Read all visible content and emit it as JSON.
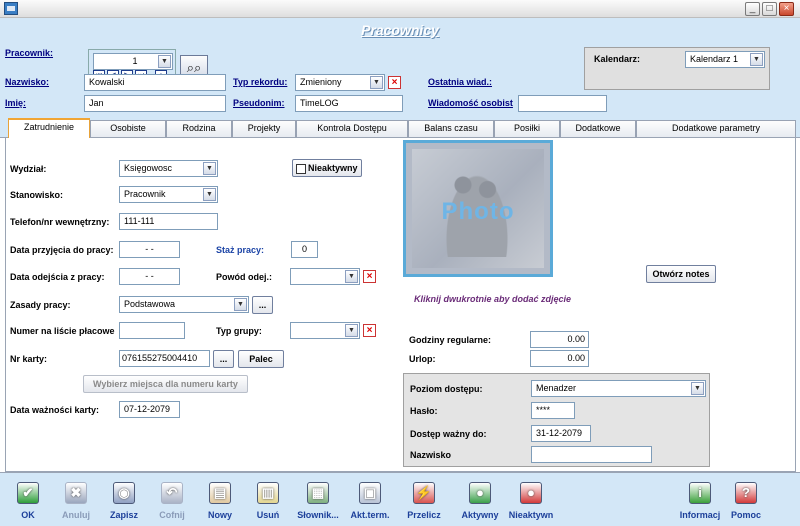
{
  "header": {
    "title": "Pracownicy",
    "pracownik_label": "Pracownik:",
    "pracownik_value": "1",
    "nazwisko_label": "Nazwisko:",
    "nazwisko_value": "Kowalski",
    "imie_label": "Imię:",
    "imie_value": "Jan",
    "typ_rekordu_label": "Typ rekordu:",
    "typ_rekordu_value": "Zmieniony",
    "pseudonim_label": "Pseudonim:",
    "pseudonim_value": "TimeLOG",
    "ostatnia_label": "Ostatnia wiad.:",
    "wiadomosc_label": "Wiadomość osobist",
    "wiadomosc_value": "",
    "kalendarz_label": "Kalendarz:",
    "kalendarz_value": "Kalendarz  1"
  },
  "tabs": [
    {
      "label": "Zatrudnienie",
      "active": true
    },
    {
      "label": "Osobiste"
    },
    {
      "label": "Rodzina"
    },
    {
      "label": "Projekty"
    },
    {
      "label": "Kontrola Dostępu"
    },
    {
      "label": "Balans czasu"
    },
    {
      "label": "Posiłki"
    },
    {
      "label": "Dodatkowe"
    },
    {
      "label": "Dodatkowe parametry"
    }
  ],
  "form": {
    "wydzial_label": "Wydział:",
    "wydzial_value": "Księgowosc",
    "nieaktywny_label": "Nieaktywny",
    "stanowisko_label": "Stanowisko:",
    "stanowisko_value": "Pracownik",
    "telefon_label": "Telefon/nr wewnętrzny:",
    "telefon_value": "111-111",
    "data_przyjecia_label": "Data przyjęcia do pracy:",
    "data_przyjecia_value": "- -",
    "staz_label": "Staż pracy:",
    "staz_value": "0",
    "data_odejscia_label": "Data odejścia z pracy:",
    "data_odejscia_value": "- -",
    "powod_label": "Powód odej.:",
    "zasady_label": "Zasady pracy:",
    "zasady_value": "Podstawowa",
    "dots": "...",
    "numer_label": "Numer na liście płacowe",
    "typ_grupy_label": "Typ grupy:",
    "nr_karty_label": "Nr karty:",
    "nr_karty_value": "076155275004410",
    "palec_label": "Palec",
    "wybierz_label": "Wybierz miejsca dla numeru karty",
    "waznosc_label": "Data ważności karty:",
    "waznosc_value": "07-12-2079"
  },
  "photo": {
    "word": "Photo",
    "hint": "Kliknij dwukrotnie aby dodać zdjęcie",
    "notes_button": "Otwórz notes"
  },
  "hours": {
    "regularne_label": "Godziny regularne:",
    "regularne_value": "0.00",
    "urlop_label": "Urlop:",
    "urlop_value": "0.00"
  },
  "access": {
    "poziom_label": "Poziom dostępu:",
    "poziom_value": "Menadzer",
    "haslo_label": "Hasło:",
    "haslo_value": "****",
    "dostep_label": "Dostęp ważny do:",
    "dostep_value": "31-12-2079",
    "nazwisko_label": "Nazwisko",
    "nazwisko_value": ""
  },
  "toolbar": [
    {
      "label": "OK",
      "icon": "check-icon",
      "color": "#2e9e3a",
      "enabled": true
    },
    {
      "label": "Anuluj",
      "icon": "cancel-icon",
      "color": "#9aa6bd",
      "enabled": false
    },
    {
      "label": "Zapisz",
      "icon": "save-icon",
      "color": "#8fa0c2",
      "enabled": true
    },
    {
      "label": "Cofnij",
      "icon": "undo-icon",
      "color": "#aab3c6",
      "enabled": false
    },
    {
      "label": "Nowy",
      "icon": "new-icon",
      "color": "#e1c9a0",
      "enabled": true
    },
    {
      "label": "Usuń",
      "icon": "delete-icon",
      "color": "#e3d690",
      "enabled": true
    },
    {
      "label": "Słownik...",
      "icon": "dictionary-icon",
      "color": "#7fb07f",
      "enabled": true
    },
    {
      "label": "Akt.term.",
      "icon": "terminal-icon",
      "color": "#b9c3d6",
      "enabled": true
    },
    {
      "label": "Przelicz",
      "icon": "recalculate-icon",
      "color": "#d9534f",
      "enabled": true
    },
    {
      "label": "Aktywny",
      "icon": "active-icon",
      "color": "#3aa04a",
      "enabled": true
    },
    {
      "label": "Nieaktywn",
      "icon": "inactive-icon",
      "color": "#d23a3a",
      "enabled": true
    },
    {
      "label": "Informacj",
      "icon": "info-icon",
      "color": "#3aa03a",
      "enabled": true
    },
    {
      "label": "Pomoc",
      "icon": "help-icon",
      "color": "#d23a3a",
      "enabled": true
    }
  ]
}
